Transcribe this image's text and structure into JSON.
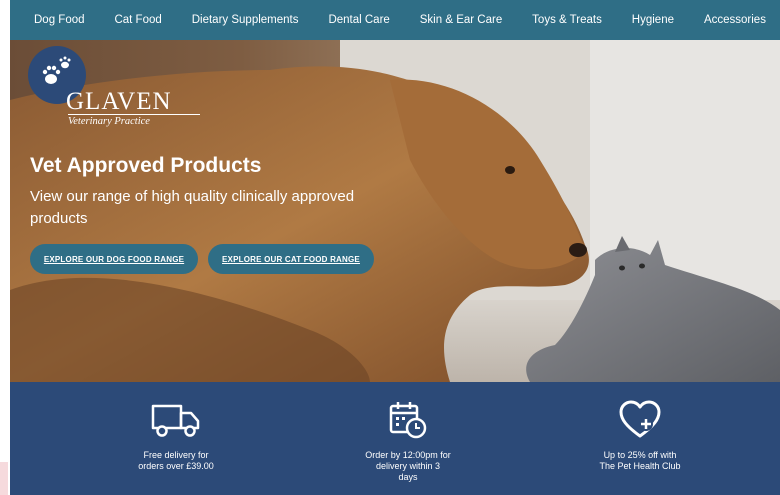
{
  "nav": {
    "items": [
      {
        "label": "Dog Food"
      },
      {
        "label": "Cat Food"
      },
      {
        "label": "Dietary Supplements"
      },
      {
        "label": "Dental Care"
      },
      {
        "label": "Skin & Ear Care"
      },
      {
        "label": "Toys & Treats"
      },
      {
        "label": "Hygiene"
      },
      {
        "label": "Accessories"
      }
    ]
  },
  "logo": {
    "name": "GLAVEN",
    "subtitle": "Veterinary Practice"
  },
  "hero": {
    "title": "Vet Approved Products",
    "subtitle": "View our range of high quality clinically approved products",
    "buttons": {
      "dog": "EXPLORE OUR DOG FOOD RANGE",
      "cat": "EXPLORE OUR CAT FOOD RANGE"
    }
  },
  "features": [
    {
      "icon": "delivery-truck-icon",
      "line1": "Free delivery for",
      "line2": "orders over £39.00",
      "line3": ""
    },
    {
      "icon": "calendar-clock-icon",
      "line1": "Order by 12:00pm for",
      "line2": "delivery within 3",
      "line3": "days"
    },
    {
      "icon": "heart-plus-icon",
      "line1": "Up to 25% off with",
      "line2": "The Pet Health Club",
      "line3": ""
    }
  ],
  "colors": {
    "nav": "#2f6e86",
    "button": "#2f6e86",
    "feature_bar": "#2c4a78",
    "logo_badge": "#2c4a78"
  }
}
